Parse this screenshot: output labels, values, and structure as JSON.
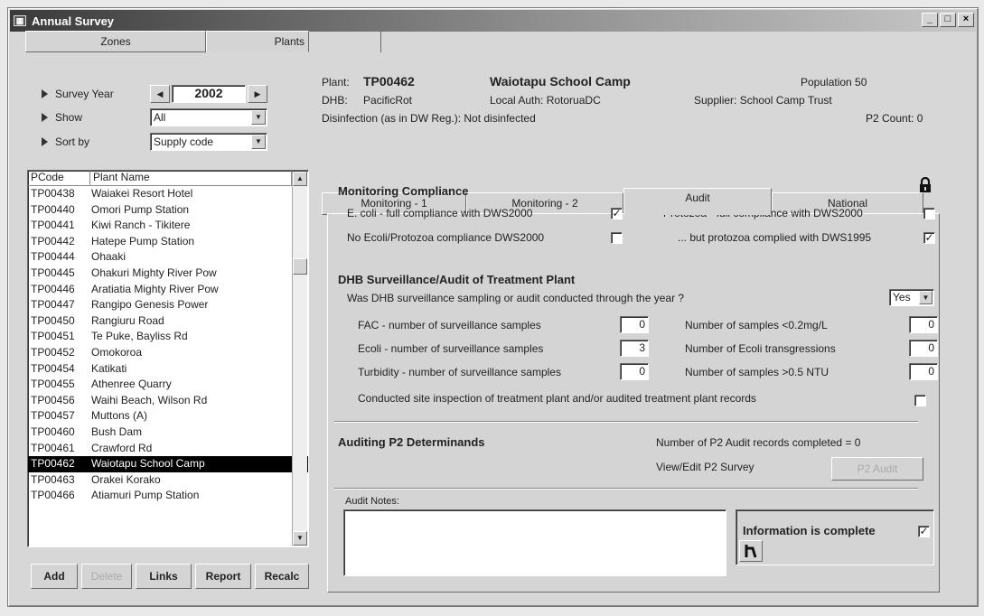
{
  "window": {
    "title": "Annual Survey",
    "sys_icon": "grid-icon"
  },
  "top_tabs": [
    {
      "label": "Zones"
    },
    {
      "label": "Plants"
    }
  ],
  "filters": {
    "year_label": "Survey Year",
    "year_value": "2002",
    "show_label": "Show",
    "show_value": "All",
    "sort_label": "Sort by",
    "sort_value": "Supply code"
  },
  "plant_list": {
    "headers": [
      "PCode",
      "Plant Name"
    ],
    "rows": [
      [
        "TP00438",
        "Waiakei Resort Hotel"
      ],
      [
        "TP00440",
        "Omori Pump Station"
      ],
      [
        "TP00441",
        "Kiwi Ranch - Tikitere"
      ],
      [
        "TP00442",
        "Hatepe Pump Station"
      ],
      [
        "TP00444",
        "Ohaaki"
      ],
      [
        "TP00445",
        "Ohakuri Mighty River Pow"
      ],
      [
        "TP00446",
        "Aratiatia Mighty River Pow"
      ],
      [
        "TP00447",
        "Rangipo Genesis Power"
      ],
      [
        "TP00450",
        "Rangiuru Road"
      ],
      [
        "TP00451",
        "Te Puke, Bayliss Rd"
      ],
      [
        "TP00452",
        "Omokoroa"
      ],
      [
        "TP00454",
        "Katikati"
      ],
      [
        "TP00455",
        "Athenree Quarry"
      ],
      [
        "TP00456",
        "Waihi Beach, Wilson Rd"
      ],
      [
        "TP00457",
        "Muttons (A)"
      ],
      [
        "TP00460",
        "Bush Dam"
      ],
      [
        "TP00461",
        "Crawford Rd"
      ],
      [
        "TP00462",
        "Waiotapu School Camp"
      ],
      [
        "TP00463",
        "Orakei Korako"
      ],
      [
        "TP00466",
        "Atiamuri Pump Station"
      ]
    ],
    "selected_index": 17
  },
  "bottom_buttons": [
    {
      "label": "Add"
    },
    {
      "label": "Delete"
    },
    {
      "label": "Links"
    },
    {
      "label": "Report"
    },
    {
      "label": "Recalc"
    }
  ],
  "plant_info": {
    "plant_label": "Plant:",
    "code": "TP00462",
    "name": "Waiotapu School Camp",
    "population": "Population  50",
    "dhb_label": "DHB:",
    "dhb": "PacificRot",
    "local_auth": "Local Auth:  RotoruaDC",
    "supplier": "Supplier:  School Camp Trust",
    "disinfection": "Disinfection (as in DW Reg.):  Not disinfected",
    "p2count": "P2 Count:  0"
  },
  "detail_tabs": [
    {
      "label": "Monitoring - 1"
    },
    {
      "label": "Monitoring - 2"
    },
    {
      "label": "Audit"
    },
    {
      "label": "National"
    }
  ],
  "monitoring": {
    "title": "Monitoring Compliance",
    "ecoli_label": "E. coli    - full compliance with DWS2000",
    "noecoli_label": "No Ecoli/Protozoa compliance DWS2000",
    "protozoa_label": "Protozoa - full compliance with DWS2000",
    "protozoa1995_label": "... but protozoa complied with DWS1995",
    "ecoli_checked": true,
    "noecoli_checked": false,
    "protozoa_checked": false,
    "protozoa1995_checked": true
  },
  "dhb_audit": {
    "title": "DHB Surveillance/Audit of Treatment Plant",
    "question": "Was DHB surveillance sampling or audit conducted through the year ?",
    "answer": "Yes",
    "fac_label": "FAC        - number of surveillance samples",
    "fac_value": "0",
    "ecoli_label": "Ecoli       - number of surveillance samples",
    "ecoli_value": "3",
    "turb_label": "Turbidity - number of surveillance samples",
    "turb_value": "0",
    "lt02_label": "Number of samples <0.2mg/L",
    "lt02_value": "0",
    "trans_label": "Number of Ecoli transgressions",
    "trans_value": "0",
    "gt05_label": "Number of samples >0.5 NTU",
    "gt05_value": "0",
    "inspection_label": "Conducted site inspection of treatment plant and/or audited treatment plant records",
    "inspection_checked": false
  },
  "p2": {
    "title": "Auditing P2 Determinands",
    "records": "Number of P2 Audit records completed = 0",
    "view_label": "View/Edit P2 Survey",
    "button": "P2 Audit"
  },
  "notes": {
    "label": "Audit Notes:",
    "value": ""
  },
  "info_complete": {
    "label": "Information is complete",
    "checked": true
  },
  "icons": {
    "lock": "lock-icon",
    "pencil": "edit-icon"
  }
}
